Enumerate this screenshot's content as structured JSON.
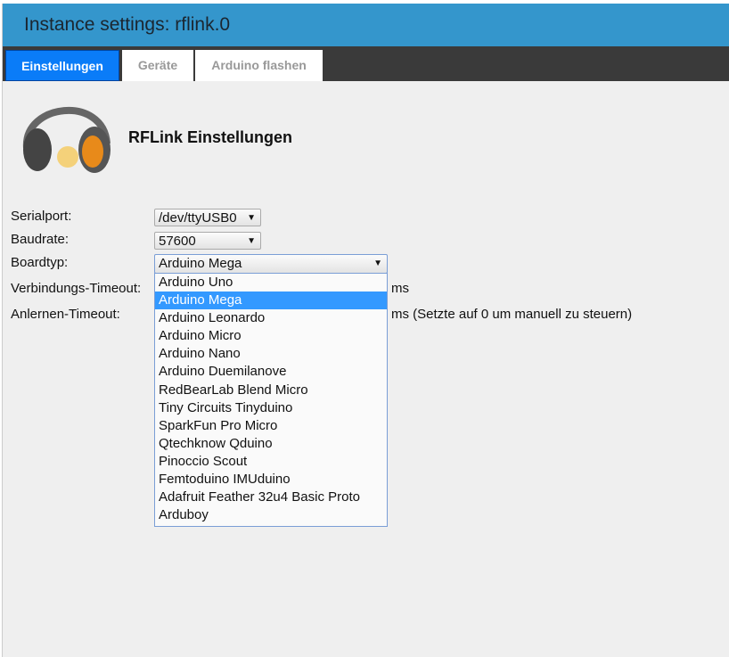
{
  "title": "Instance settings: rflink.0",
  "tabs": [
    "Einstellungen",
    "Geräte",
    "Arduino flashen"
  ],
  "heading": "RFLink Einstellungen",
  "fields": {
    "serialport": {
      "label": "Serialport:",
      "value": "/dev/ttyUSB0"
    },
    "baudrate": {
      "label": "Baudrate:",
      "value": "57600"
    },
    "boardtyp": {
      "label": "Boardtyp:",
      "value": "Arduino Mega"
    },
    "verbindungs_timeout": {
      "label": "Verbindungs-Timeout:",
      "unit": "ms"
    },
    "anlernen_timeout": {
      "label": "Anlernen-Timeout:",
      "unit": "ms (Setzte auf 0 um manuell zu steuern)"
    }
  },
  "board_options": [
    "Arduino Uno",
    "Arduino Mega",
    "Arduino Leonardo",
    "Arduino Micro",
    "Arduino Nano",
    "Arduino Duemilanove",
    "RedBearLab Blend Micro",
    "Tiny Circuits Tinyduino",
    "SparkFun Pro Micro",
    "Qtechknow Qduino",
    "Pinoccio Scout",
    "Femtoduino IMUduino",
    "Adafruit Feather 32u4 Basic Proto",
    "Arduboy"
  ],
  "selected_index": 1,
  "colors": {
    "titlebar": "#3496cc",
    "active_tab": "#0a7cf8",
    "highlight": "#3399ff"
  }
}
